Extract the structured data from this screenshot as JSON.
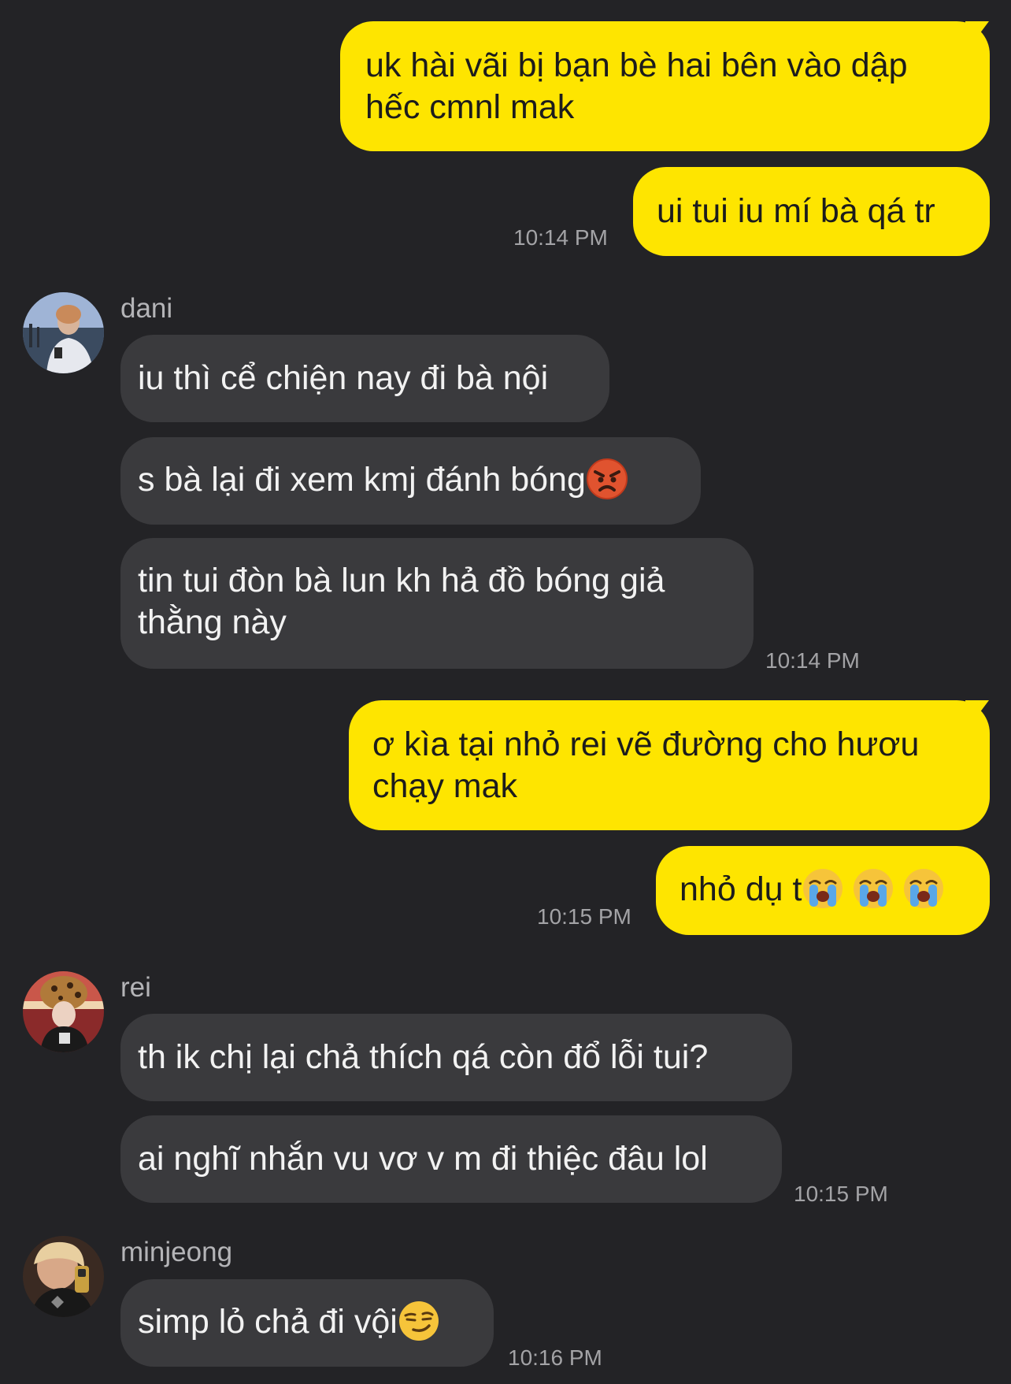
{
  "messages": [
    {
      "text": "uk hài vãi bị bạn bè hai bên vào dập hếc cmnl mak"
    },
    {
      "text": "ui tui iu mí bà qá tr",
      "time": "10:14 PM"
    },
    {
      "sender": "dani"
    },
    {
      "text": "iu thì cể chiện nay đi bà nội"
    },
    {
      "text": "s bà lại đi xem kmj đánh bóng",
      "emoji": "angry-face"
    },
    {
      "text": "tin tui đòn bà lun kh hả đồ bóng giả thằng này",
      "time": "10:14 PM"
    },
    {
      "text": "ơ kìa tại nhỏ rei vẽ đường cho hươu chạy mak"
    },
    {
      "text": "nhỏ dụ t",
      "emoji": "loudly-crying-face",
      "time": "10:15 PM"
    },
    {
      "sender": "rei"
    },
    {
      "text": "th ik chị lại chả thích qá còn đổ lỗi tui?"
    },
    {
      "text": "ai nghĩ nhắn vu vơ v m đi thiệc đâu lol",
      "time": "10:15 PM"
    },
    {
      "sender": "minjeong"
    },
    {
      "text": "simp lỏ chả đi vội",
      "emoji": "smirking-face",
      "time": "10:16 PM"
    }
  ],
  "colors": {
    "background": "#232326",
    "outgoing_bubble": "#FEE500",
    "incoming_bubble": "#3a3a3d",
    "timestamp": "#a3a3a6"
  }
}
